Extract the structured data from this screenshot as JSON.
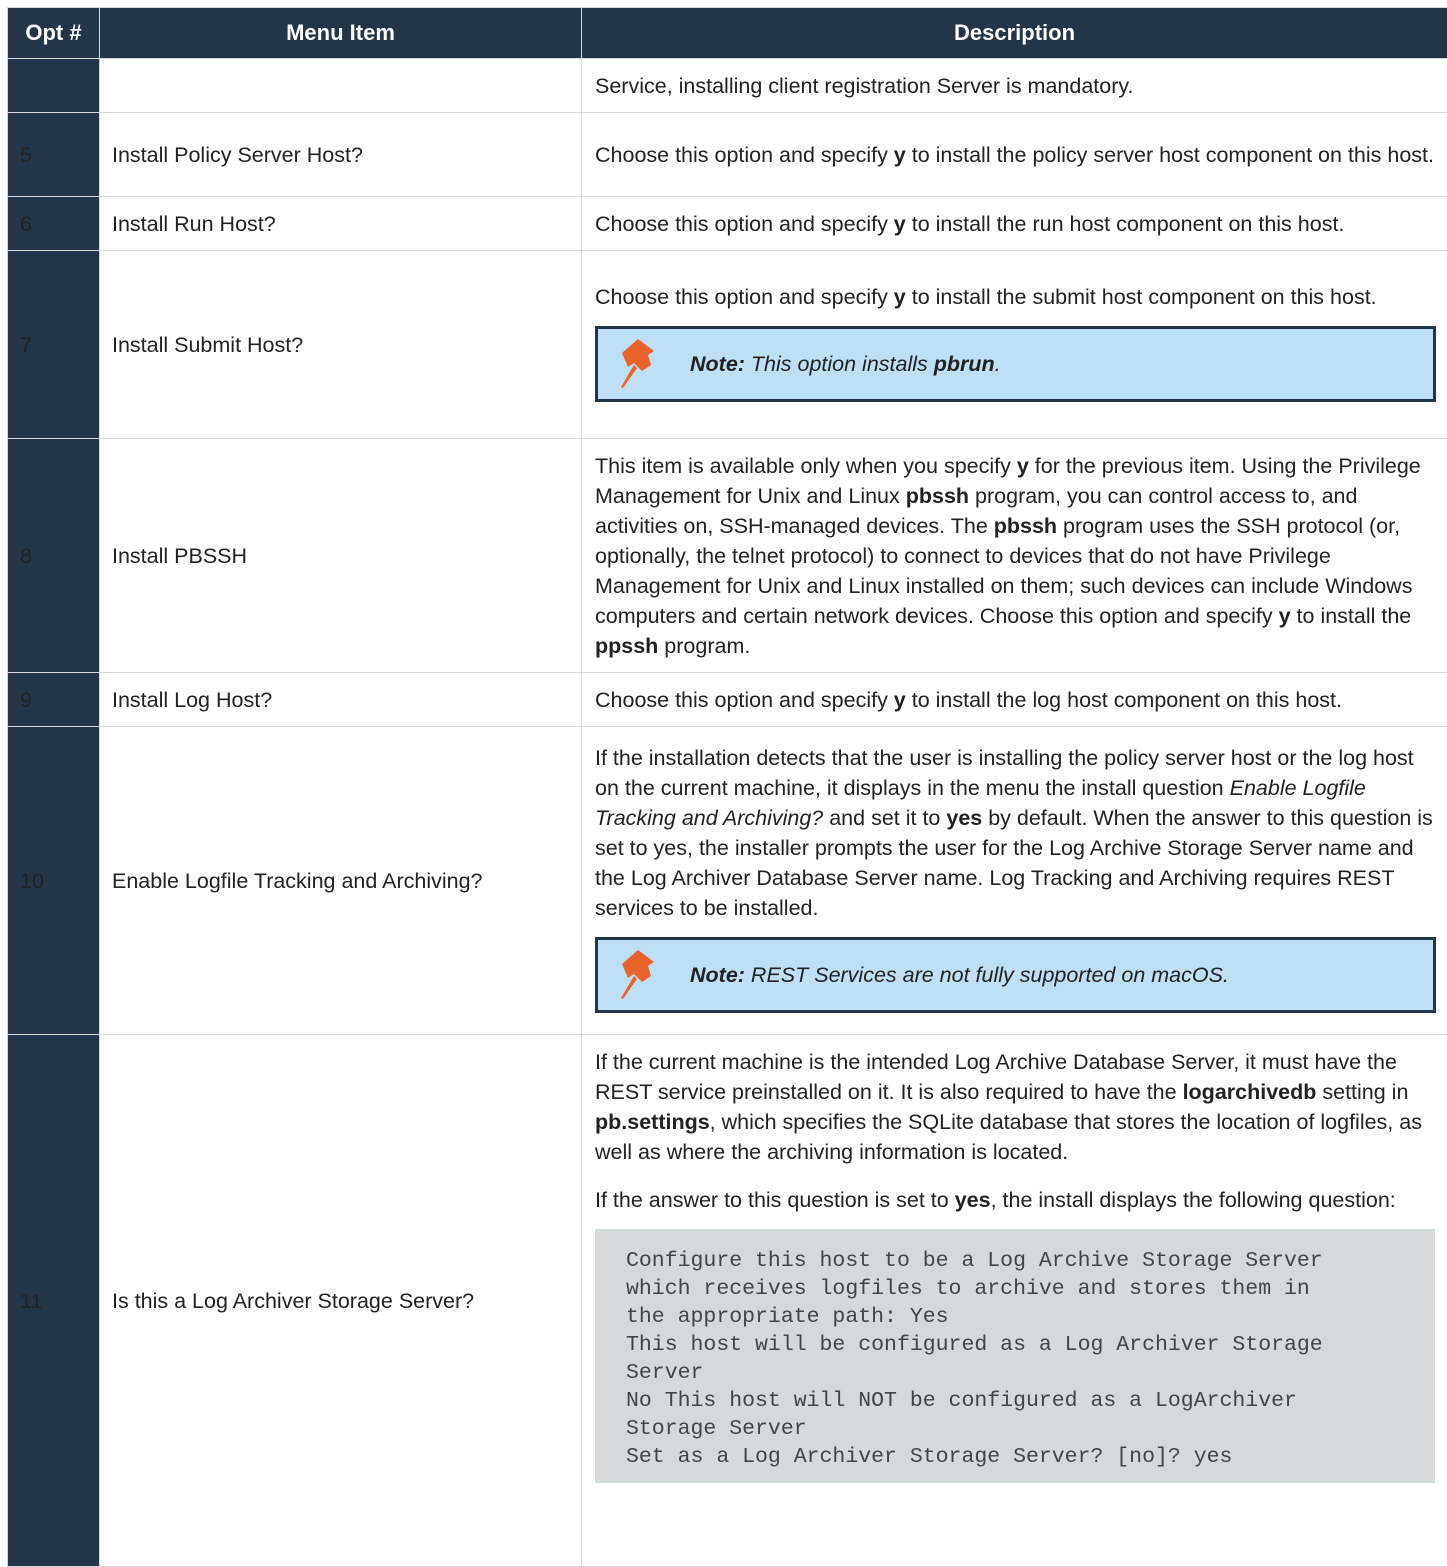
{
  "header": {
    "opt": "Opt #",
    "menu": "Menu Item",
    "desc": "Description"
  },
  "rows": [
    {
      "num": "",
      "item": "",
      "desc": "Service, installing client registration Server is mandatory."
    },
    {
      "num": "5",
      "item": "Install Policy Server Host?",
      "desc_a": "Choose this option and specify ",
      "desc_b": "y",
      "desc_c": " to install the policy server host component on this host."
    },
    {
      "num": "6",
      "item": "Install Run Host?",
      "desc_a": "Choose this option and specify ",
      "desc_b": "y",
      "desc_c": " to install the run host component on this host."
    },
    {
      "num": "7",
      "item": "Install Submit Host?",
      "desc_a": "Choose this option and specify ",
      "desc_b": "y",
      "desc_c": " to install the submit host component on this host.",
      "note_label": "Note:",
      "note_text": " This option installs ",
      "note_bold": "pbrun",
      "note_end": "."
    },
    {
      "num": "8",
      "item": "Install PBSSH",
      "p1": "This item is available only when you specify ",
      "p2": "y",
      "p3": " for the previous item. Using the Privilege Management for Unix and Linux ",
      "p4": "pbssh",
      "p5": " program, you can control access to, and activities on, SSH-managed devices. The ",
      "p6": "pbssh",
      "p7": " program uses the SSH protocol (or, optionally, the telnet protocol) to connect to devices that do not have Privilege Management for Unix and Linux installed on them; such devices can include Windows computers and certain network devices. Choose this option and specify ",
      "p8": "y",
      "p9": " to install the ",
      "p10": "ppssh",
      "p11": " program."
    },
    {
      "num": "9",
      "item": "Install Log Host?",
      "desc_a": "Choose this option and specify ",
      "desc_b": "y",
      "desc_c": " to install the log host component on this host."
    },
    {
      "num": "10",
      "item": "Enable Logfile Tracking and Archiving?",
      "p1": "If the installation detects that the user is installing the policy server host or the log host on the current machine, it displays in the menu the install question ",
      "p2": "Enable Logfile Tracking and Archiving?",
      "p3": " and set it to ",
      "p4": "yes",
      "p5": " by default. When the answer to this question is set to yes, the installer prompts the user for the Log Archive Storage Server name and the Log Archiver Database Server name. Log Tracking and Archiving requires REST services to be installed.",
      "note_label": "Note:",
      "note_text": " REST Services are not fully supported on macOS."
    },
    {
      "num": "11",
      "item": "Is this a Log Archiver Storage Server?",
      "p1": "If the current machine is the intended Log Archive Database Server, it must have the REST service preinstalled on it. It is also required to have the ",
      "p2": "logarchivedb",
      "p3": " setting in ",
      "p4": "pb.settings",
      "p5": ", which specifies the SQLite database that stores the location of logfiles, as well as where the archiving information is located.",
      "q1": "If the answer to this question is set to ",
      "q2": "yes",
      "q3": ", the install displays the following question:",
      "code": [
        "Configure this host to be a Log Archive Storage Server",
        "which receives logfiles to archive and stores them in",
        "the appropriate path: Yes",
        "This host will be configured as a Log Archiver Storage",
        "Server",
        "No This host will NOT be configured as a LogArchiver",
        "Storage Server",
        "Set as a Log Archiver Storage Server? [no]? yes"
      ]
    }
  ]
}
